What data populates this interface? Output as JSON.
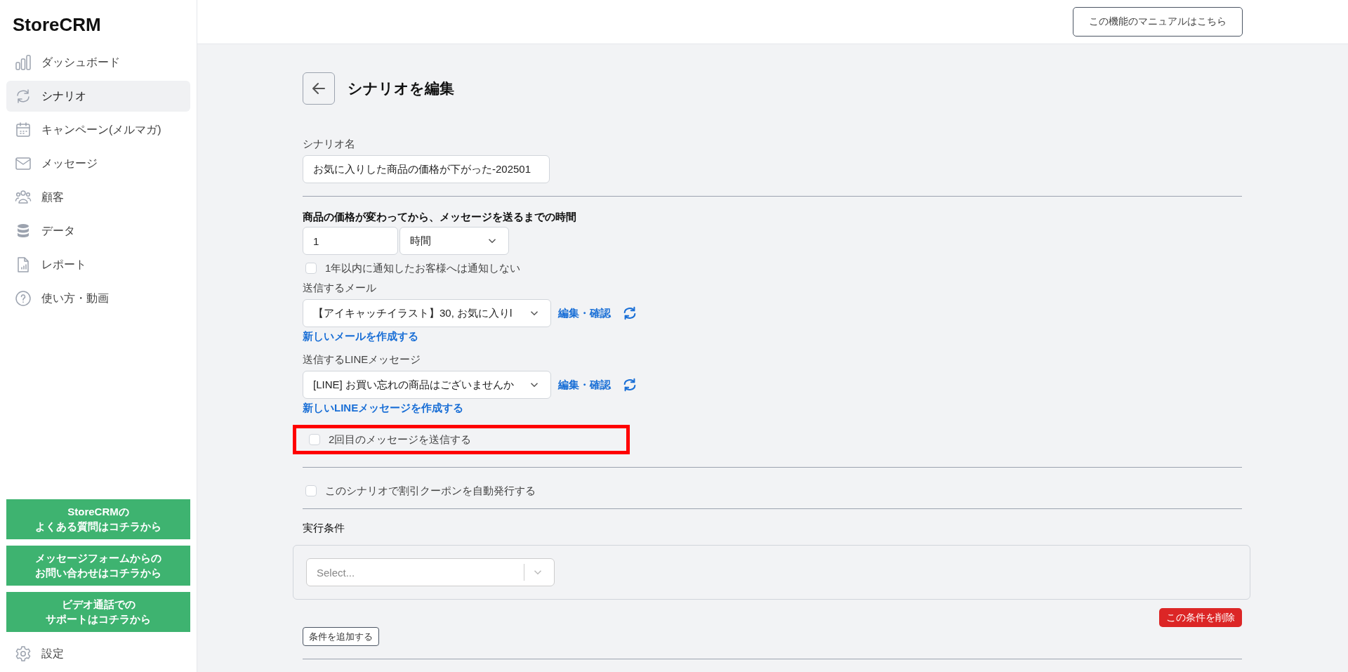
{
  "sidebar": {
    "logo": "StoreCRM",
    "items": [
      {
        "label": "ダッシュボード",
        "kind": "bars",
        "selected": false
      },
      {
        "label": "シナリオ",
        "kind": "cycle",
        "selected": true
      },
      {
        "label": "キャンペーン(メルマガ)",
        "kind": "calendar",
        "selected": false
      },
      {
        "label": "メッセージ",
        "kind": "mail",
        "selected": false
      },
      {
        "label": "顧客",
        "kind": "people",
        "selected": false
      },
      {
        "label": "データ",
        "kind": "database",
        "selected": false
      },
      {
        "label": "レポート",
        "kind": "report",
        "selected": false
      },
      {
        "label": "使い方・動画",
        "kind": "help",
        "selected": false
      }
    ],
    "help_buttons": [
      [
        "StoreCRMの",
        "よくある質問はコチラから"
      ],
      [
        "メッセージフォームからの",
        "お問い合わせはコチラから"
      ],
      [
        "ビデオ通話での",
        "サポートはコチラから"
      ]
    ],
    "settings": "設定"
  },
  "header": {
    "manual_button": "この機能のマニュアルはこちら"
  },
  "page": {
    "title": "シナリオを編集",
    "name_label": "シナリオ名",
    "name_value": "お気に入りした商品の価格が下がった-202501",
    "delay_label": "商品の価格が変わってから、メッセージを送るまでの時間",
    "delay_value": "1",
    "delay_unit": "時間",
    "skip_checkbox": {
      "label": "1年以内に通知したお客様へは通知しない",
      "checked": false
    },
    "mail_label": "送信するメール",
    "mail_value": "【アイキャッチイラスト】30, お気に入りl",
    "mail_edit": "編集・確認",
    "mail_new": "新しいメールを作成する",
    "line_label": "送信するLINEメッセージ",
    "line_value": "[LINE] お買い忘れの商品はございませんか",
    "line_edit": "編集・確認",
    "line_new": "新しいLINEメッセージを作成する",
    "second_checkbox": {
      "label": "2回目のメッセージを送信する",
      "checked": false,
      "highlighted": true
    },
    "coupon_checkbox": {
      "label": "このシナリオで割引クーポンを自動発行する",
      "checked": false
    },
    "conditions_label": "実行条件",
    "condition_placeholder": "Select...",
    "delete_button": "この条件を削除",
    "add_button": "条件を追加する"
  }
}
